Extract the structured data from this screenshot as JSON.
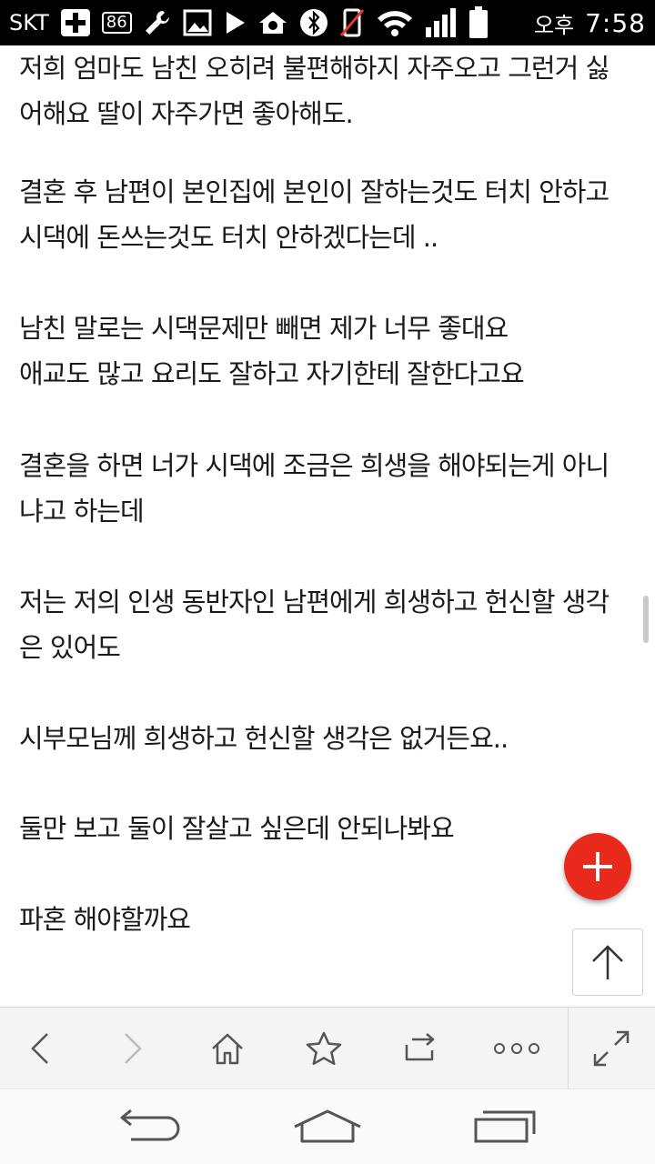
{
  "status_bar": {
    "carrier": "SKT",
    "notification_badge": "86",
    "ampm": "오후",
    "time": "7:58"
  },
  "article": {
    "paragraphs": [
      {
        "lines": [
          "저희 엄마도 남친 오히려 불편해하지 자주오고 그런거 싫",
          "어해요 딸이 자주가면 좋아해도."
        ]
      },
      {
        "lines": [
          "결혼 후 남편이 본인집에 본인이 잘하는것도 터치 안하고",
          "시댁에 돈쓰는것도 터치 안하겠다는데 .."
        ]
      },
      {
        "lines": [
          "남친 말로는 시댁문제만 빼면 제가 너무 좋대요",
          "애교도 많고 요리도 잘하고 자기한테 잘한다고요"
        ]
      },
      {
        "lines": [
          "결혼을 하면 너가 시댁에 조금은 희생을 해야되는게 아니",
          "냐고 하는데"
        ]
      },
      {
        "lines": [
          "저는 저의 인생 동반자인 남편에게 희생하고 헌신할 생각",
          "은 있어도"
        ]
      },
      {
        "lines": [
          "시부모님께 희생하고 헌신할 생각은 없거든요.."
        ]
      },
      {
        "lines": [
          "둘만 보고 둘이 잘살고 싶은데 안되나봐요"
        ]
      },
      {
        "lines": [
          "파혼 해야할까요"
        ]
      }
    ]
  },
  "colors": {
    "fab": "#e8291c",
    "icon": "#555555"
  },
  "toolbar": {
    "buttons": [
      "back-icon",
      "forward-icon",
      "home-icon",
      "bookmark-star-icon",
      "tabs-switch-icon",
      "more-icon",
      "fullscreen-icon"
    ]
  },
  "navbar": {
    "buttons": [
      "nav-back-icon",
      "nav-home-icon",
      "nav-recents-icon"
    ]
  }
}
